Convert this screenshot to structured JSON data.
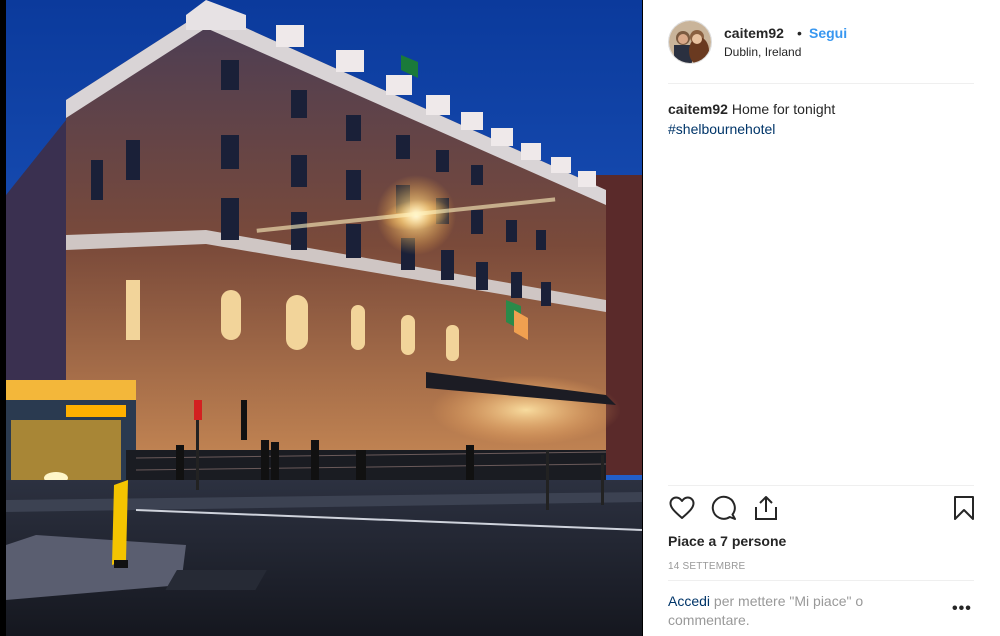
{
  "post": {
    "username": "caitem92",
    "separator": "•",
    "follow_label": "Segui",
    "location": "Dublin, Ireland",
    "caption_user": "caitem92",
    "caption_text": "Home for tonight",
    "hashtag": "#shelbournehotel",
    "likes_text": "Piace a 7 persone",
    "date": "14 SETTEMBRE",
    "login_link": "Accedi",
    "login_rest": "per mettere \"Mi piace\" o commentare.",
    "more_label": "•••"
  },
  "icons": {
    "like": "heart-icon",
    "comment": "comment-icon",
    "share": "share-icon",
    "save": "bookmark-icon",
    "more": "ellipsis-icon"
  },
  "colors": {
    "link_blue": "#3897f0",
    "hashtag_blue": "#003569",
    "text": "#262626",
    "muted": "#999999",
    "divider": "#efefef"
  }
}
